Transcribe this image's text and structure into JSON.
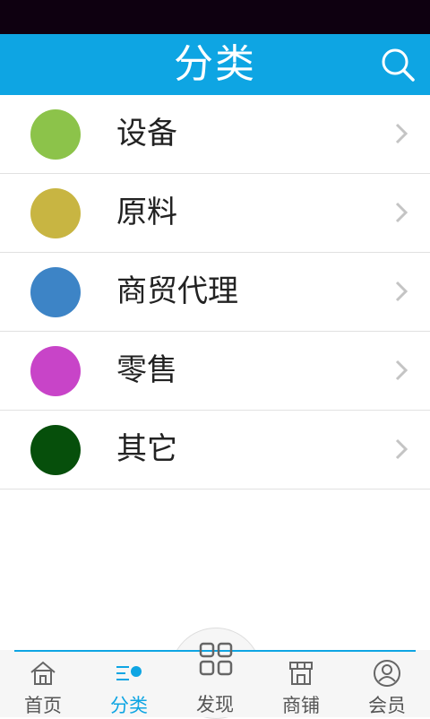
{
  "header": {
    "title": "分类"
  },
  "categories": [
    {
      "label": "设备",
      "color": "#8cc34a"
    },
    {
      "label": "原料",
      "color": "#c8b542"
    },
    {
      "label": "商贸代理",
      "color": "#3d84c6"
    },
    {
      "label": "零售",
      "color": "#c844c8"
    },
    {
      "label": "其它",
      "color": "#064f0b"
    }
  ],
  "tabbar": {
    "home": {
      "label": "首页",
      "icon": "home-icon"
    },
    "category": {
      "label": "分类",
      "icon": "category-icon"
    },
    "discover": {
      "label": "发现",
      "icon": "grid-icon"
    },
    "shop": {
      "label": "商铺",
      "icon": "store-icon"
    },
    "member": {
      "label": "会员",
      "icon": "user-icon"
    }
  },
  "colors": {
    "accent": "#0ea5e3",
    "status_bar": "#0e0010"
  }
}
